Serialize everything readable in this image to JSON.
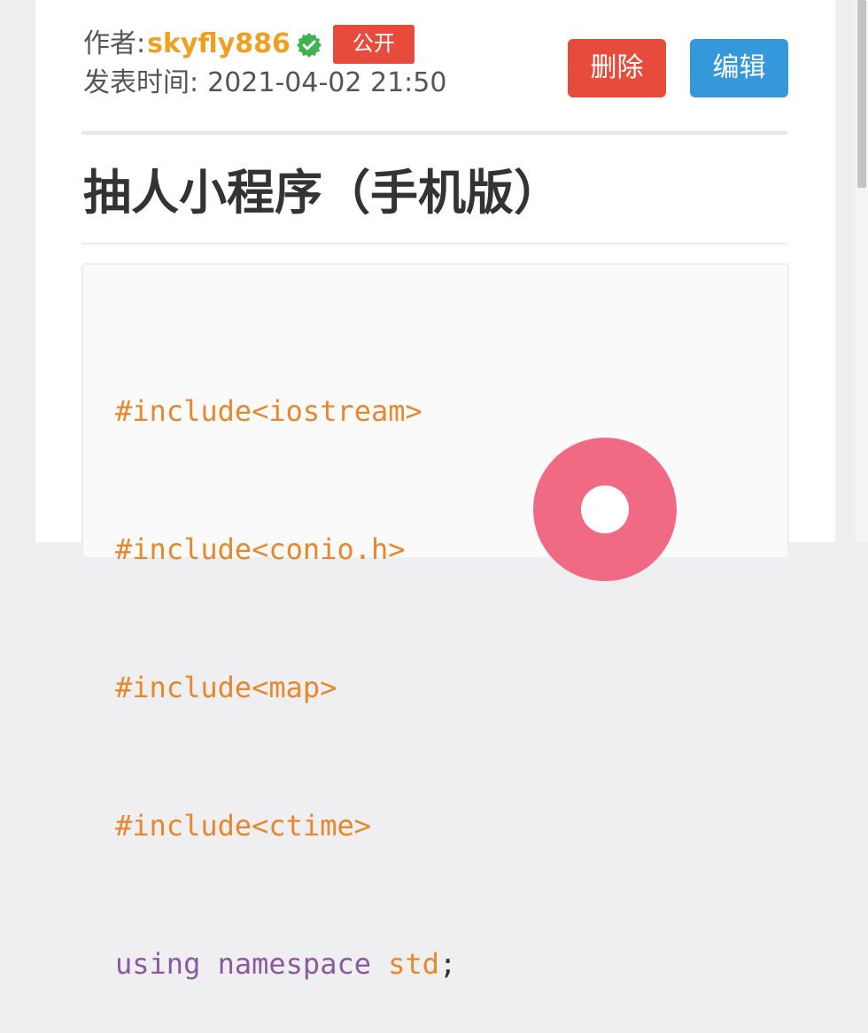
{
  "meta": {
    "author_label": "作者:",
    "author_name": "skyfly886",
    "public_badge": "公开",
    "time_label": "发表时间:",
    "time_value": "2021-04-02 21:50"
  },
  "actions": {
    "delete_label": "删除",
    "edit_label": "编辑"
  },
  "post": {
    "title": "抽人小程序（手机版）"
  },
  "code": {
    "lines": [
      "#include<iostream>",
      "#include<conio.h>",
      "#include<map>",
      "#include<ctime>"
    ],
    "using_kw": "using",
    "namespace_kw": "namespace",
    "std_id": "std",
    "semicolon": ";"
  },
  "icons": {
    "verified": "verified-check-icon",
    "floating": "record-icon"
  },
  "colors": {
    "author": "#f0a020",
    "delete": "#e64b3c",
    "edit": "#3498db",
    "verified": "#3fb34f",
    "floating": "#f06a84",
    "preprocessor": "#e8872c",
    "keyword": "#8a5a9e"
  }
}
